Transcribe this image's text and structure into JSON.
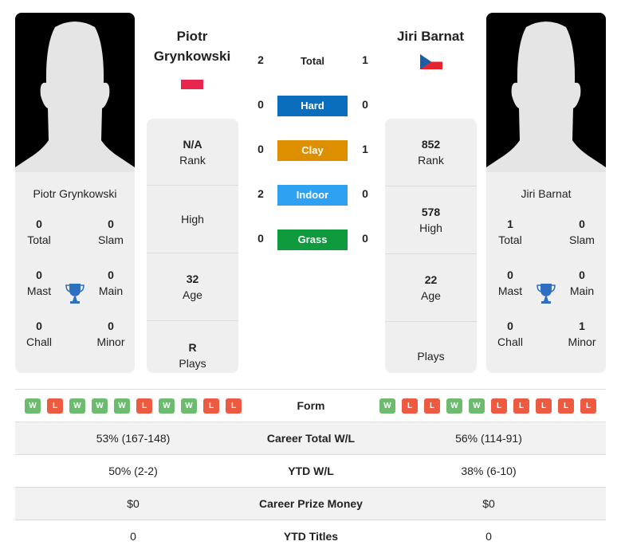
{
  "players": {
    "left": {
      "name_line1": "Piotr",
      "name_line2": "Grynkowski",
      "card_name": "Piotr Grynkowski",
      "flag": "poland-flag",
      "titles": {
        "total": {
          "value": "0",
          "label": "Total"
        },
        "slam": {
          "value": "0",
          "label": "Slam"
        },
        "mast": {
          "value": "0",
          "label": "Mast"
        },
        "main": {
          "value": "0",
          "label": "Main"
        },
        "chall": {
          "value": "0",
          "label": "Chall"
        },
        "minor": {
          "value": "0",
          "label": "Minor"
        }
      },
      "stats": [
        {
          "value": "N/A",
          "label": "Rank"
        },
        {
          "value": "",
          "label": "High"
        },
        {
          "value": "32",
          "label": "Age"
        },
        {
          "value": "R",
          "label": "Plays"
        }
      ],
      "form": [
        "W",
        "L",
        "W",
        "W",
        "W",
        "L",
        "W",
        "W",
        "L",
        "L"
      ]
    },
    "right": {
      "name": "Jiri Barnat",
      "card_name": "Jiri Barnat",
      "flag": "czech-flag",
      "titles": {
        "total": {
          "value": "1",
          "label": "Total"
        },
        "slam": {
          "value": "0",
          "label": "Slam"
        },
        "mast": {
          "value": "0",
          "label": "Mast"
        },
        "main": {
          "value": "0",
          "label": "Main"
        },
        "chall": {
          "value": "0",
          "label": "Chall"
        },
        "minor": {
          "value": "1",
          "label": "Minor"
        }
      },
      "stats": [
        {
          "value": "852",
          "label": "Rank"
        },
        {
          "value": "578",
          "label": "High"
        },
        {
          "value": "22",
          "label": "Age"
        },
        {
          "value": "",
          "label": "Plays"
        }
      ],
      "form": [
        "W",
        "L",
        "L",
        "W",
        "W",
        "L",
        "L",
        "L",
        "L",
        "L"
      ]
    }
  },
  "h2h": {
    "total": {
      "label": "Total",
      "left": "2",
      "right": "1"
    },
    "surfaces": [
      {
        "label": "Hard",
        "left": "0",
        "right": "0",
        "color": "#0a6ebd"
      },
      {
        "label": "Clay",
        "left": "0",
        "right": "1",
        "color": "#dd8f00"
      },
      {
        "label": "Indoor",
        "left": "2",
        "right": "0",
        "color": "#2ea1f2"
      },
      {
        "label": "Grass",
        "left": "0",
        "right": "0",
        "color": "#0e9a3d"
      }
    ]
  },
  "form_label": "Form",
  "comparison": [
    {
      "label": "Career Total W/L",
      "left": "53% (167-148)",
      "right": "56% (114-91)"
    },
    {
      "label": "YTD W/L",
      "left": "50% (2-2)",
      "right": "38% (6-10)"
    },
    {
      "label": "Career Prize Money",
      "left": "$0",
      "right": "$0"
    },
    {
      "label": "YTD Titles",
      "left": "0",
      "right": "0"
    }
  ]
}
